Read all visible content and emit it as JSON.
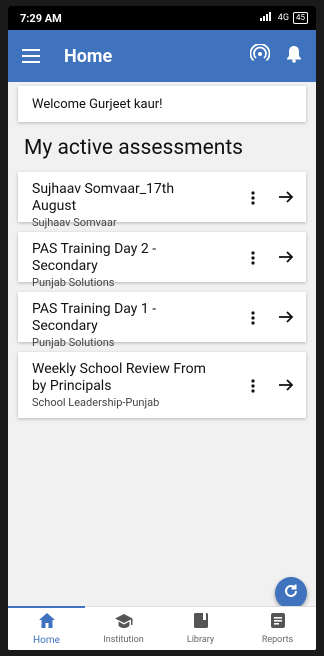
{
  "status_bar": {
    "time": "7:29 AM",
    "network": "4G",
    "battery": "45"
  },
  "app_bar": {
    "title": "Home",
    "icons": [
      "menu-icon",
      "broadcast-icon",
      "bell-icon"
    ]
  },
  "welcome": "Welcome Gurjeet kaur!",
  "section_title": "My active assessments",
  "assessments": [
    {
      "title": "Sujhaav Somvaar_17th August",
      "subtitle": "Sujhaav Somvaar"
    },
    {
      "title": "PAS Training Day 2 - Secondary",
      "subtitle": "Punjab Solutions"
    },
    {
      "title": "PAS Training Day 1 - Secondary",
      "subtitle": "Punjab Solutions"
    },
    {
      "title": "Weekly School Review From by Principals",
      "subtitle": "School Leadership-Punjab"
    }
  ],
  "fab": {
    "icon": "refresh-icon"
  },
  "bottom_nav": [
    {
      "label": "Home",
      "icon": "home-icon",
      "active": true
    },
    {
      "label": "Institution",
      "icon": "school-icon",
      "active": false
    },
    {
      "label": "Library",
      "icon": "book-icon",
      "active": false
    },
    {
      "label": "Reports",
      "icon": "reports-icon",
      "active": false
    }
  ],
  "colors": {
    "primary": "#3f73bd",
    "background": "#f1f1f1",
    "card": "#ffffff"
  }
}
